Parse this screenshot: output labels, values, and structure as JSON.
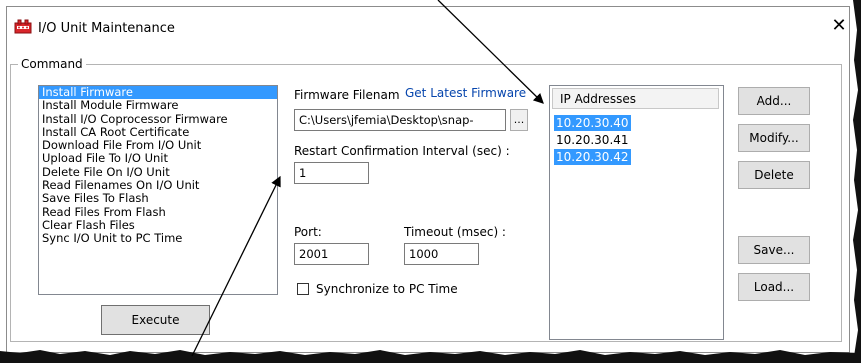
{
  "window": {
    "title": "I/O Unit Maintenance",
    "close_glyph": "✕",
    "icon": "io-unit-red-icon"
  },
  "command": {
    "group_label": "Command",
    "items": [
      "Install Firmware",
      "Install Module Firmware",
      "Install I/O Coprocessor Firmware",
      "Install CA Root Certificate",
      "Download File From I/O Unit",
      "Upload File To I/O Unit",
      "Delete File On I/O Unit",
      "Read Filenames On I/O Unit",
      "Save Files To Flash",
      "Read Files From Flash",
      "Clear Flash Files",
      "Sync I/O Unit to PC Time"
    ],
    "selected_index": 0,
    "execute_label": "Execute"
  },
  "firmware": {
    "label": "Firmware Filenam",
    "link": "Get Latest Firmware",
    "value": "C:\\Users\\jfemia\\Desktop\\snap-",
    "browse_label": "..."
  },
  "restart": {
    "label": "Restart Confirmation Interval (sec) :",
    "value": "1"
  },
  "port": {
    "label": "Port:",
    "value": "2001"
  },
  "timeout": {
    "label": "Timeout (msec) :",
    "value": "1000"
  },
  "sync": {
    "label": "Synchronize to PC Time",
    "checked": false
  },
  "ip": {
    "header": "IP Addresses",
    "items": [
      {
        "address": "10.20.30.40",
        "selected": true
      },
      {
        "address": "10.20.30.41",
        "selected": false
      },
      {
        "address": "10.20.30.42",
        "selected": true
      }
    ]
  },
  "buttons": {
    "add": "Add...",
    "modify": "Modify...",
    "delete": "Delete",
    "save": "Save...",
    "load": "Load..."
  },
  "colors": {
    "selection": "#3399ff",
    "link": "#0645ad",
    "icon_red": "#d9262b"
  }
}
